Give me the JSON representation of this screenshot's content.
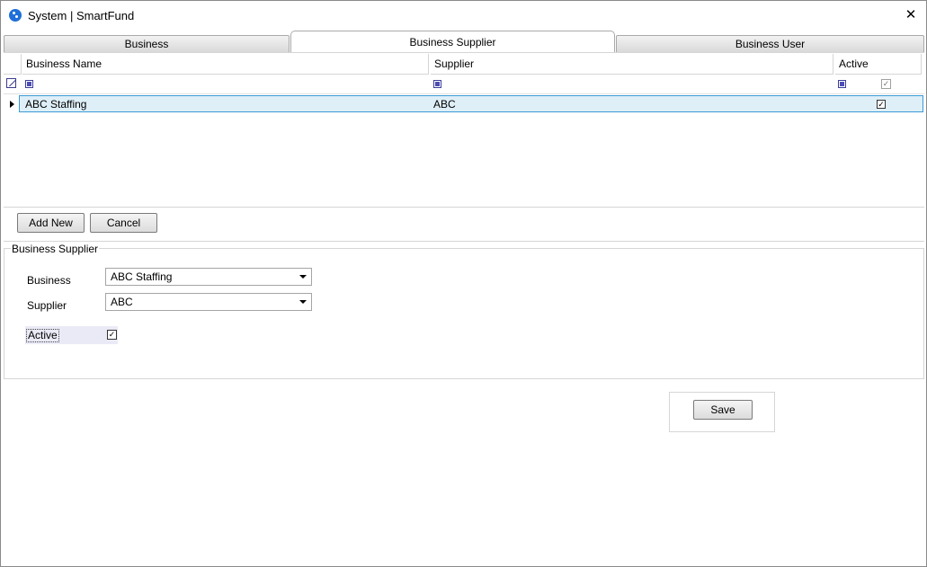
{
  "window": {
    "title": "System | SmartFund",
    "close_glyph": "✕"
  },
  "tabs": [
    {
      "label": "Business"
    },
    {
      "label": "Business Supplier"
    },
    {
      "label": "Business User"
    }
  ],
  "active_tab": "Business Supplier",
  "grid": {
    "columns": [
      "Business Name",
      "Supplier",
      "Active"
    ],
    "rows": [
      {
        "business_name": "ABC Staffing",
        "supplier": "ABC",
        "active_mark": "✓"
      }
    ],
    "filter_active_mark": "✓"
  },
  "buttons": {
    "add_new": "Add New",
    "cancel": "Cancel",
    "save": "Save"
  },
  "form": {
    "group_title": "Business Supplier",
    "business_label": "Business",
    "business_value": "ABC Staffing",
    "supplier_label": "Supplier",
    "supplier_value": "ABC",
    "active_label": "Active",
    "active_mark": "✓"
  },
  "colors": {
    "selected_row_bg": "#dfeff8",
    "selected_row_border": "#3a9bd6",
    "app_icon": "#1e6fd9"
  }
}
